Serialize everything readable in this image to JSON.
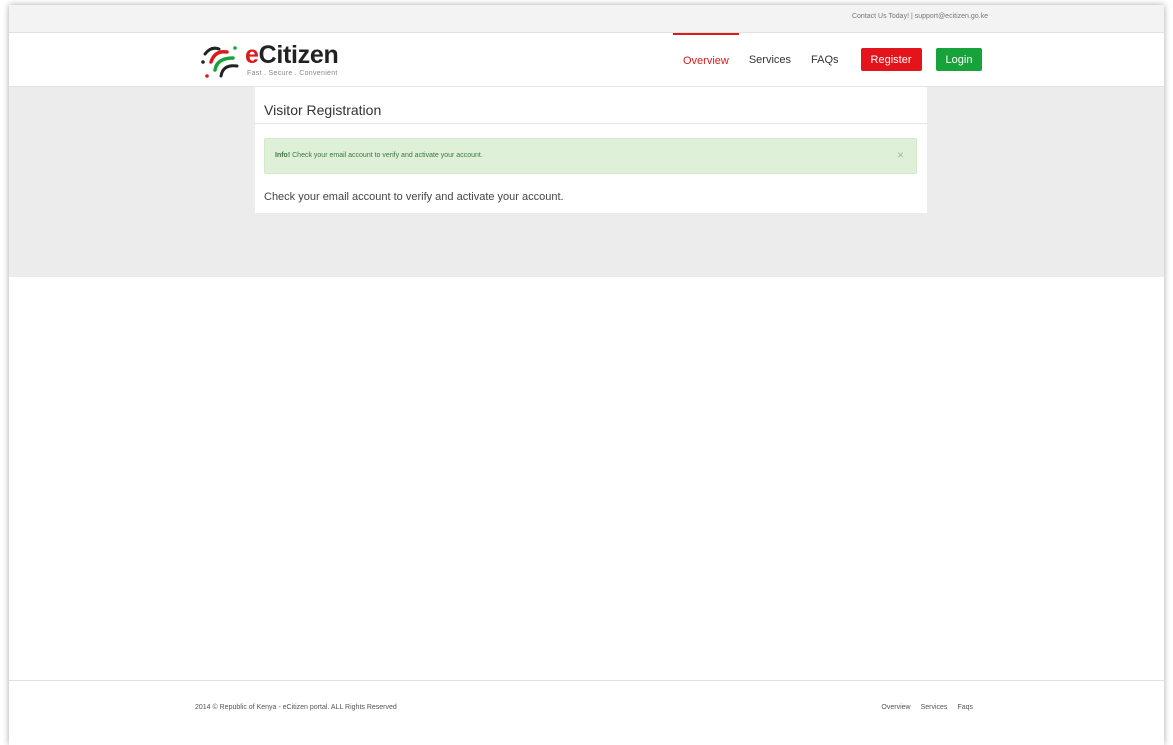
{
  "topbar": {
    "contact_text": "Contact Us Today! | support@ecitizen.go.ke"
  },
  "brand": {
    "name_prefix": "e",
    "name_rest": "Citizen",
    "tagline": "Fast . Secure . Convenient",
    "accent_color": "#d91b1b"
  },
  "nav": {
    "items": [
      {
        "label": "Overview",
        "active": true
      },
      {
        "label": "Services",
        "active": false
      },
      {
        "label": "FAQs",
        "active": false
      }
    ],
    "register_label": "Register",
    "login_label": "Login",
    "register_color": "#e3141b",
    "login_color": "#18a33a"
  },
  "panel": {
    "title": "Visitor Registration",
    "alert": {
      "prefix": "Info!",
      "text": " Check your email account to verify and activate your account.",
      "close_symbol": "×"
    },
    "message": "Check your email account to verify and activate your account."
  },
  "footer": {
    "copyright": "2014 © Republic of Kenya - eCitizen portal. ALL Rights Reserved",
    "links": [
      "Overview",
      "Services",
      "Faqs"
    ]
  },
  "icons": {
    "logo": "ecitizen-logo-icon",
    "close": "close-icon"
  }
}
